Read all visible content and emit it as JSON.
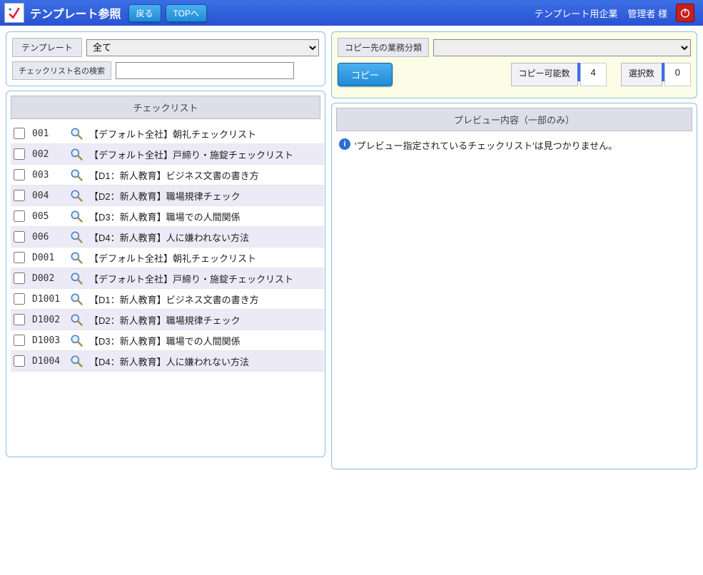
{
  "header": {
    "title": "テンプレート参照",
    "back_label": "戻る",
    "top_label": "TOPへ",
    "company": "テンプレート用企業",
    "user": "管理者 様"
  },
  "left": {
    "filter": {
      "template_label": "テンプレート",
      "template_selected": "全て",
      "search_label": "チェックリスト名の検索",
      "search_value": ""
    },
    "list_header": "チェックリスト",
    "rows": [
      {
        "code": "001",
        "title": "【デフォルト全社】朝礼チェックリスト"
      },
      {
        "code": "002",
        "title": "【デフォルト全社】戸締り・施錠チェックリスト"
      },
      {
        "code": "003",
        "title": "【D1：新人教育】ビジネス文書の書き方"
      },
      {
        "code": "004",
        "title": "【D2：新人教育】職場規律チェック"
      },
      {
        "code": "005",
        "title": "【D3：新人教育】職場での人間関係"
      },
      {
        "code": "006",
        "title": "【D4：新人教育】人に嫌われない方法"
      },
      {
        "code": "D001",
        "title": "【デフォルト全社】朝礼チェックリスト"
      },
      {
        "code": "D002",
        "title": "【デフォルト全社】戸締り・施錠チェックリスト"
      },
      {
        "code": "D1001",
        "title": "【D1：新人教育】ビジネス文書の書き方"
      },
      {
        "code": "D1002",
        "title": "【D2：新人教育】職場規律チェック"
      },
      {
        "code": "D1003",
        "title": "【D3：新人教育】職場での人間関係"
      },
      {
        "code": "D1004",
        "title": "【D4：新人教育】人に嫌われない方法"
      }
    ]
  },
  "right": {
    "copy_category_label": "コピー先の業務分類",
    "copy_category_selected": "",
    "copy_button": "コピー",
    "copyable_label": "コピー可能数",
    "copyable_value": "4",
    "selected_label": "選択数",
    "selected_value": "0",
    "preview_header": "プレビュー内容（一部のみ）",
    "preview_info": "'プレビュー指定されているチェックリスト'は見つかりません。"
  }
}
